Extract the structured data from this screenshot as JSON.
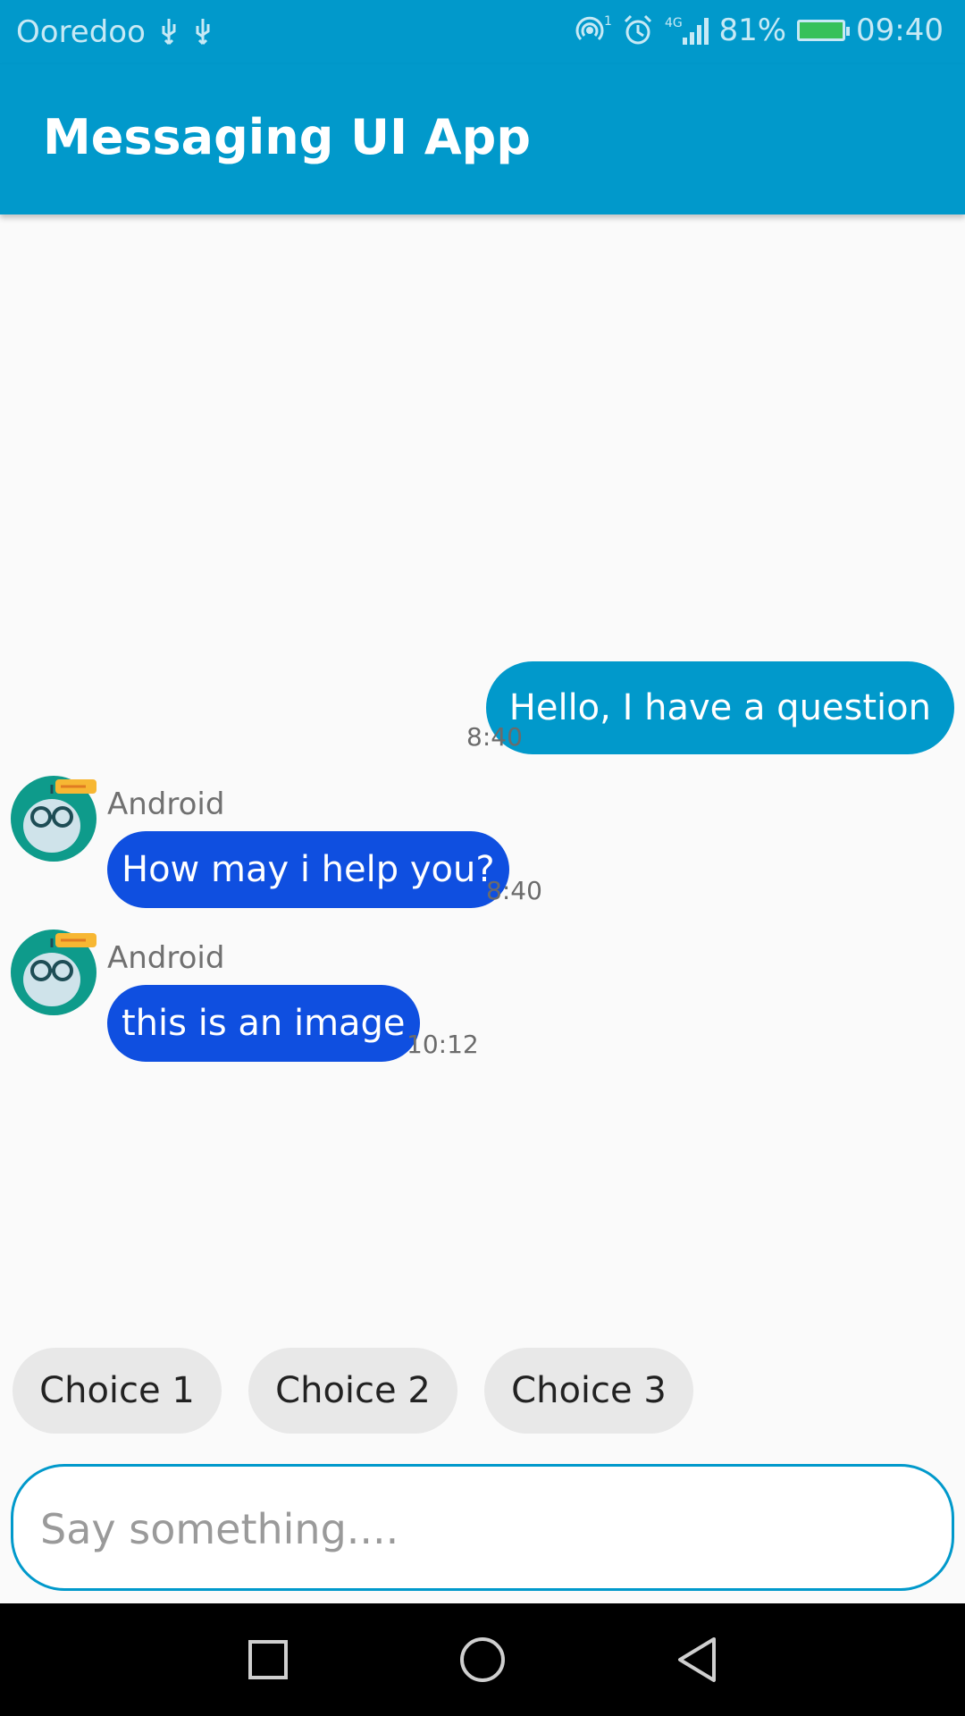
{
  "status_bar": {
    "carrier": "Ooredoo",
    "battery": "81%",
    "time": "09:40",
    "network": "4G",
    "icons": [
      "usb-icon",
      "usb-icon",
      "hotspot-icon",
      "alarm-icon",
      "signal-icon",
      "battery-icon"
    ]
  },
  "app_bar": {
    "title": "Messaging UI App"
  },
  "messages": [
    {
      "direction": "outgoing",
      "text": "Hello, I have a question",
      "time": "8:40"
    },
    {
      "direction": "incoming",
      "sender": "Android",
      "text": "How may i help you?",
      "time": "8:40"
    },
    {
      "direction": "incoming",
      "sender": "Android",
      "text": "this is an image",
      "time": "10:12"
    }
  ],
  "choices": [
    {
      "label": "Choice 1"
    },
    {
      "label": "Choice 2"
    },
    {
      "label": "Choice 3"
    }
  ],
  "input": {
    "placeholder": "Say something....",
    "value": ""
  },
  "colors": {
    "primary": "#0199cb",
    "incoming_bubble": "#0f4fe0",
    "chip_bg": "#e8e8e8",
    "nav_bg": "#000000"
  },
  "nav_icons": [
    "recent-apps-icon",
    "home-icon",
    "back-icon"
  ]
}
